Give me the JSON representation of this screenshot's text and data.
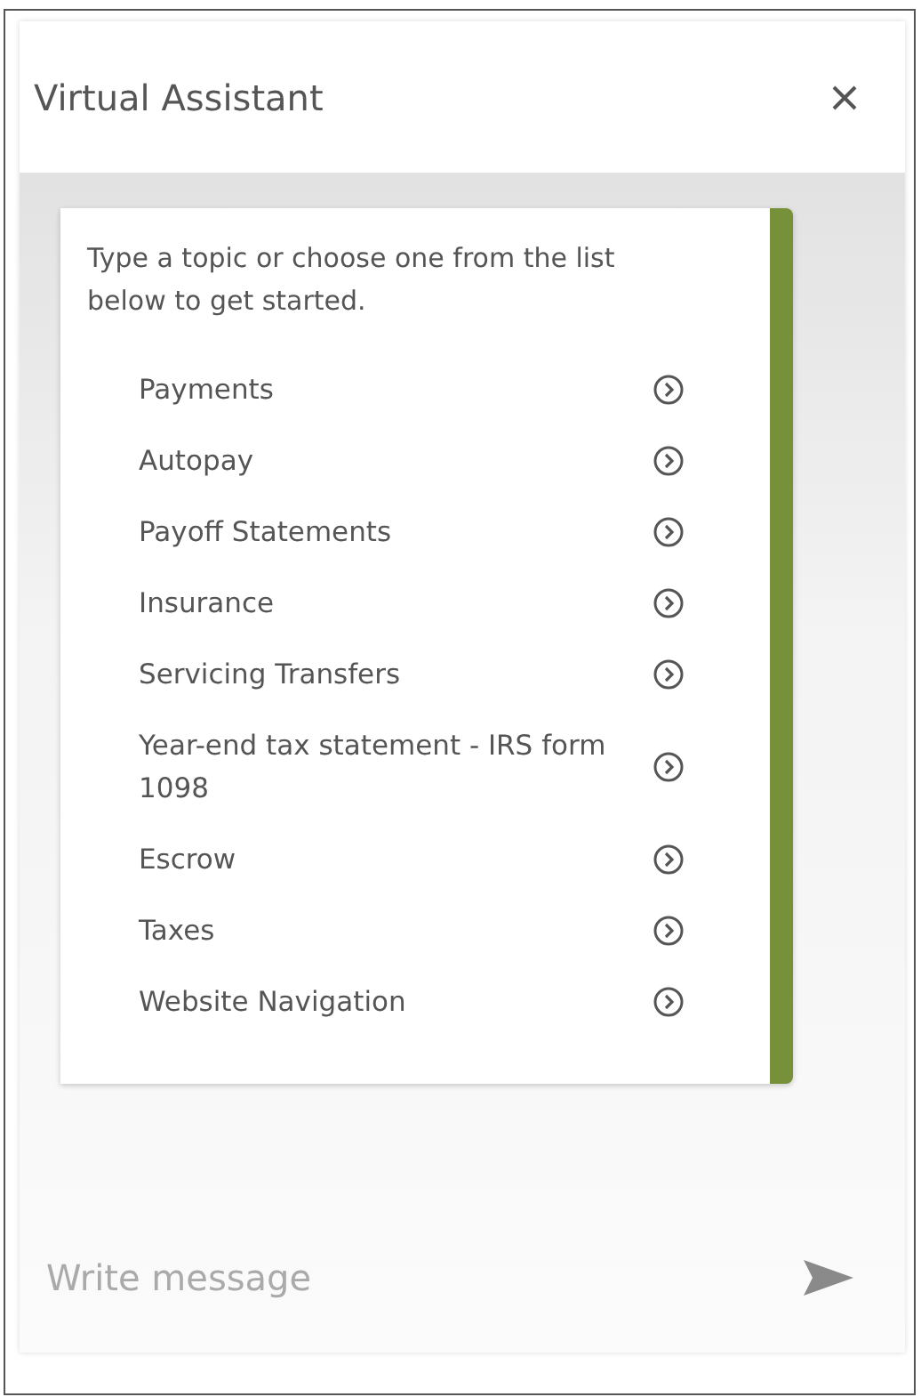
{
  "window": {
    "title": "Virtual Assistant"
  },
  "intro": "Type a topic or choose one from the list below to get started.",
  "topics": [
    {
      "label": "Payments"
    },
    {
      "label": "Autopay"
    },
    {
      "label": "Payoff Statements"
    },
    {
      "label": "Insurance"
    },
    {
      "label": "Servicing Transfers"
    },
    {
      "label": "Year-end tax statement - IRS form 1098"
    },
    {
      "label": "Escrow"
    },
    {
      "label": "Taxes"
    },
    {
      "label": "Website Navigation"
    }
  ],
  "composer": {
    "placeholder": "Write message"
  }
}
